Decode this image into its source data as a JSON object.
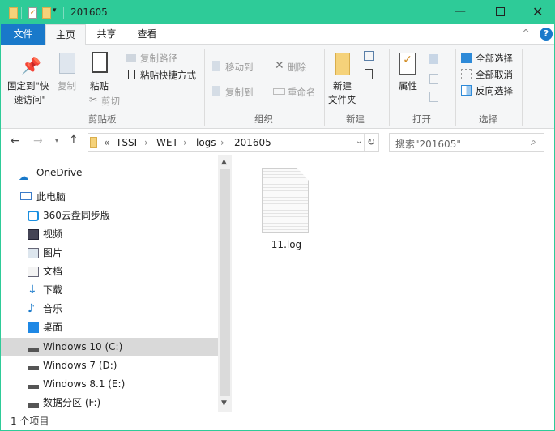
{
  "window": {
    "title": "201605",
    "accent": "#2ecb98"
  },
  "tabs": {
    "file": "文件",
    "home": "主页",
    "share": "共享",
    "view": "查看"
  },
  "ribbon": {
    "pin_quick_access_line1": "固定到\"快",
    "pin_quick_access_line2": "速访问\"",
    "copy": "复制",
    "paste": "粘贴",
    "copy_path": "复制路径",
    "paste_shortcut": "粘贴快捷方式",
    "cut": "剪切",
    "clipboard_group": "剪贴板",
    "move_to": "移动到",
    "copy_to": "复制到",
    "delete": "删除",
    "rename": "重命名",
    "organize_group": "组织",
    "new_folder_line1": "新建",
    "new_folder_line2": "文件夹",
    "new_group": "新建",
    "properties": "属性",
    "open_group": "打开",
    "select_all": "全部选择",
    "select_none": "全部取消",
    "invert_selection": "反向选择",
    "select_group": "选择"
  },
  "address": {
    "prefix": "«",
    "crumbs": [
      "TSSI",
      "WET",
      "logs",
      "201605"
    ]
  },
  "search": {
    "placeholder": "搜索\"201605\""
  },
  "sidebar": {
    "items": [
      {
        "label": "OneDrive"
      },
      {
        "label": "此电脑"
      },
      {
        "label": "360云盘同步版"
      },
      {
        "label": "视频"
      },
      {
        "label": "图片"
      },
      {
        "label": "文档"
      },
      {
        "label": "下载"
      },
      {
        "label": "音乐"
      },
      {
        "label": "桌面"
      },
      {
        "label": "Windows 10 (C:)"
      },
      {
        "label": "Windows 7 (D:)"
      },
      {
        "label": "Windows 8.1 (E:)"
      },
      {
        "label": "数据分区 (F:)"
      }
    ]
  },
  "files": [
    {
      "name": "11.log"
    }
  ],
  "status": {
    "count": "1 个项目"
  }
}
